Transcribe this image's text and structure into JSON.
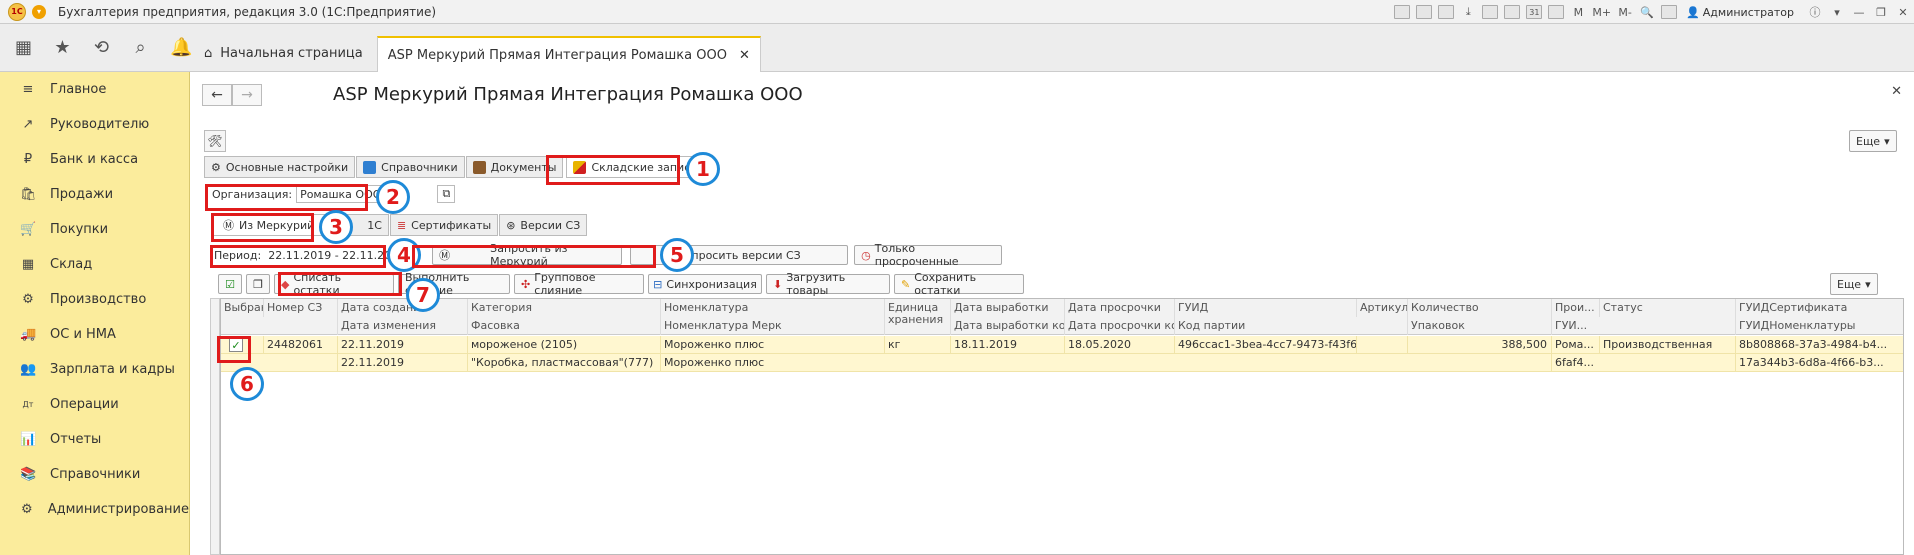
{
  "window": {
    "title": "Бухгалтерия предприятия, редакция 3.0  (1С:Предприятие)",
    "user": "Администратор",
    "mem_labels": [
      "M",
      "M+",
      "M-"
    ]
  },
  "nav": {
    "home_tab": "Начальная страница",
    "active_tab": "ASP Меркурий Прямая Интеграция Ромашка ООО"
  },
  "sidebar": {
    "items": [
      {
        "label": "Главное",
        "icon": "≡"
      },
      {
        "label": "Руководителю",
        "icon": "↗"
      },
      {
        "label": "Банк и касса",
        "icon": "₽"
      },
      {
        "label": "Продажи",
        "icon": "🛍"
      },
      {
        "label": "Покупки",
        "icon": "🛒"
      },
      {
        "label": "Склад",
        "icon": "▦"
      },
      {
        "label": "Производство",
        "icon": "⚙"
      },
      {
        "label": "ОС и НМА",
        "icon": "🚚"
      },
      {
        "label": "Зарплата и кадры",
        "icon": "👥"
      },
      {
        "label": "Операции",
        "icon": "Дт"
      },
      {
        "label": "Отчеты",
        "icon": "📊"
      },
      {
        "label": "Справочники",
        "icon": "📚"
      },
      {
        "label": "Администрирование",
        "icon": "⚙"
      }
    ]
  },
  "form": {
    "title": "ASP Меркурий Прямая Интеграция Ромашка ООО",
    "more_label": "Еще",
    "main_tabs": [
      "Основные настройки",
      "Справочники",
      "Документы",
      "Складские записи"
    ],
    "org_label": "Организация:",
    "org_value": "Ромашка ООО",
    "sub_tabs": [
      "Из Меркурий",
      "1С",
      "Сертификаты",
      "Версии СЗ"
    ],
    "period_label": "Период:",
    "period_value": "22.11.2019 - 22.11.2019",
    "btn_request": "Запросить из Меркурий",
    "btn_request_versions": "Запросить версии СЗ",
    "btn_overdue": "Только просроченные",
    "btn_writeoff": "Списать остатки",
    "btn_merge": "Выполнить слияние",
    "btn_group_merge": "Групповое слияние",
    "btn_sync": "Синхронизация",
    "btn_load": "Загрузить товары",
    "btn_save": "Сохранить остатки"
  },
  "grid": {
    "header_top": [
      "Выбран",
      "Номер СЗ",
      "Дата создания",
      "Категория",
      "Номенклатура",
      "Единица хранения",
      "Дата выработки",
      "Дата просрочки",
      "ГУИД",
      "Артикул",
      "Количество",
      "Прои...",
      "Статус",
      "ГУИДСертификата"
    ],
    "header_bottom": [
      "Дата изменения",
      "Фасовка",
      "Номенклатура Мерк",
      "Дата выработки кон",
      "Дата просрочки кон",
      "Код партии",
      "Упаковок",
      "ГУИ...",
      "ГУИДНоменклатуры"
    ],
    "row1": {
      "number": "24482061",
      "created": "22.11.2019",
      "category": "мороженое (2105)",
      "nomenclature": "Мороженко плюс",
      "unit": "кг",
      "produced": "18.11.2019",
      "expires": "18.05.2020",
      "guid": "496ccac1-3bea-4cc7-9473-f43f68...",
      "quantity": "388,500",
      "producer": "Рома...",
      "status": "Производственная",
      "cert_guid": "8b808868-37a3-4984-b4..."
    },
    "row2": {
      "changed": "22.11.2019",
      "packing": "\"Коробка, пластмассовая\"(777)",
      "nomenclature_merc": "Мороженко плюс",
      "producer_guid": "6faf4...",
      "nom_guid": "17a344b3-6d8a-4f66-b3..."
    }
  },
  "badges": [
    "1",
    "2",
    "3",
    "4",
    "5",
    "6",
    "7"
  ]
}
